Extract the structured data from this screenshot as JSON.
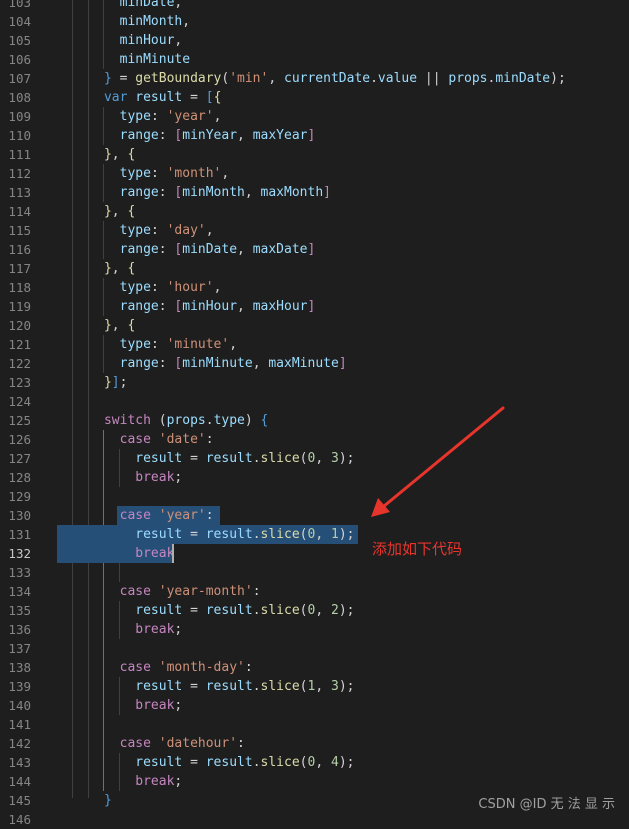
{
  "colors": {
    "background": "#1e1e1e",
    "line_number": "#858585",
    "variable": "#9cdcfe",
    "keyword_control": "#c586c0",
    "keyword": "#569cd6",
    "function": "#dcdcaa",
    "string": "#ce9178",
    "number": "#b5cea8",
    "selection": "#264f78",
    "annotation": "#e8352c"
  },
  "editor": {
    "active_line": 132,
    "lines": [
      {
        "num": "103",
        "tokens": [
          {
            "t": "        "
          },
          {
            "t": "minDate",
            "c": "variable"
          },
          {
            "t": ","
          }
        ]
      },
      {
        "num": "104",
        "tokens": [
          {
            "t": "        "
          },
          {
            "t": "minMonth",
            "c": "variable"
          },
          {
            "t": ","
          }
        ]
      },
      {
        "num": "105",
        "tokens": [
          {
            "t": "        "
          },
          {
            "t": "minHour",
            "c": "variable"
          },
          {
            "t": ","
          }
        ]
      },
      {
        "num": "106",
        "tokens": [
          {
            "t": "        "
          },
          {
            "t": "minMinute",
            "c": "variable"
          }
        ]
      },
      {
        "num": "107",
        "tokens": [
          {
            "t": "      "
          },
          {
            "t": "}",
            "c": "keyword"
          },
          {
            "t": " = "
          },
          {
            "t": "getBoundary",
            "c": "function"
          },
          {
            "t": "("
          },
          {
            "t": "'min'",
            "c": "string"
          },
          {
            "t": ", "
          },
          {
            "t": "currentDate",
            "c": "variable"
          },
          {
            "t": "."
          },
          {
            "t": "value",
            "c": "variable"
          },
          {
            "t": " || "
          },
          {
            "t": "props",
            "c": "variable"
          },
          {
            "t": "."
          },
          {
            "t": "minDate",
            "c": "variable"
          },
          {
            "t": ");"
          }
        ]
      },
      {
        "num": "108",
        "tokens": [
          {
            "t": "      "
          },
          {
            "t": "var",
            "c": "keyword"
          },
          {
            "t": " "
          },
          {
            "t": "result",
            "c": "variable"
          },
          {
            "t": " = "
          },
          {
            "t": "[",
            "c": "keyword"
          },
          {
            "t": "{",
            "c": "function"
          }
        ]
      },
      {
        "num": "109",
        "tokens": [
          {
            "t": "        "
          },
          {
            "t": "type",
            "c": "variable"
          },
          {
            "t": ": "
          },
          {
            "t": "'year'",
            "c": "string"
          },
          {
            "t": ","
          }
        ]
      },
      {
        "num": "110",
        "tokens": [
          {
            "t": "        "
          },
          {
            "t": "range",
            "c": "variable"
          },
          {
            "t": ": "
          },
          {
            "t": "[",
            "c": "keyword_control"
          },
          {
            "t": "minYear",
            "c": "variable"
          },
          {
            "t": ", "
          },
          {
            "t": "maxYear",
            "c": "variable"
          },
          {
            "t": "]",
            "c": "keyword_control"
          }
        ]
      },
      {
        "num": "111",
        "tokens": [
          {
            "t": "      "
          },
          {
            "t": "}",
            "c": "function"
          },
          {
            "t": ", "
          },
          {
            "t": "{",
            "c": "function"
          }
        ]
      },
      {
        "num": "112",
        "tokens": [
          {
            "t": "        "
          },
          {
            "t": "type",
            "c": "variable"
          },
          {
            "t": ": "
          },
          {
            "t": "'month'",
            "c": "string"
          },
          {
            "t": ","
          }
        ]
      },
      {
        "num": "113",
        "tokens": [
          {
            "t": "        "
          },
          {
            "t": "range",
            "c": "variable"
          },
          {
            "t": ": "
          },
          {
            "t": "[",
            "c": "keyword_control"
          },
          {
            "t": "minMonth",
            "c": "variable"
          },
          {
            "t": ", "
          },
          {
            "t": "maxMonth",
            "c": "variable"
          },
          {
            "t": "]",
            "c": "keyword_control"
          }
        ]
      },
      {
        "num": "114",
        "tokens": [
          {
            "t": "      "
          },
          {
            "t": "}",
            "c": "function"
          },
          {
            "t": ", "
          },
          {
            "t": "{",
            "c": "function"
          }
        ]
      },
      {
        "num": "115",
        "tokens": [
          {
            "t": "        "
          },
          {
            "t": "type",
            "c": "variable"
          },
          {
            "t": ": "
          },
          {
            "t": "'day'",
            "c": "string"
          },
          {
            "t": ","
          }
        ]
      },
      {
        "num": "116",
        "tokens": [
          {
            "t": "        "
          },
          {
            "t": "range",
            "c": "variable"
          },
          {
            "t": ": "
          },
          {
            "t": "[",
            "c": "keyword_control"
          },
          {
            "t": "minDate",
            "c": "variable"
          },
          {
            "t": ", "
          },
          {
            "t": "maxDate",
            "c": "variable"
          },
          {
            "t": "]",
            "c": "keyword_control"
          }
        ]
      },
      {
        "num": "117",
        "tokens": [
          {
            "t": "      "
          },
          {
            "t": "}",
            "c": "function"
          },
          {
            "t": ", "
          },
          {
            "t": "{",
            "c": "function"
          }
        ]
      },
      {
        "num": "118",
        "tokens": [
          {
            "t": "        "
          },
          {
            "t": "type",
            "c": "variable"
          },
          {
            "t": ": "
          },
          {
            "t": "'hour'",
            "c": "string"
          },
          {
            "t": ","
          }
        ]
      },
      {
        "num": "119",
        "tokens": [
          {
            "t": "        "
          },
          {
            "t": "range",
            "c": "variable"
          },
          {
            "t": ": "
          },
          {
            "t": "[",
            "c": "keyword_control"
          },
          {
            "t": "minHour",
            "c": "variable"
          },
          {
            "t": ", "
          },
          {
            "t": "maxHour",
            "c": "variable"
          },
          {
            "t": "]",
            "c": "keyword_control"
          }
        ]
      },
      {
        "num": "120",
        "tokens": [
          {
            "t": "      "
          },
          {
            "t": "}",
            "c": "function"
          },
          {
            "t": ", "
          },
          {
            "t": "{",
            "c": "function"
          }
        ]
      },
      {
        "num": "121",
        "tokens": [
          {
            "t": "        "
          },
          {
            "t": "type",
            "c": "variable"
          },
          {
            "t": ": "
          },
          {
            "t": "'minute'",
            "c": "string"
          },
          {
            "t": ","
          }
        ]
      },
      {
        "num": "122",
        "tokens": [
          {
            "t": "        "
          },
          {
            "t": "range",
            "c": "variable"
          },
          {
            "t": ": "
          },
          {
            "t": "[",
            "c": "keyword_control"
          },
          {
            "t": "minMinute",
            "c": "variable"
          },
          {
            "t": ", "
          },
          {
            "t": "maxMinute",
            "c": "variable"
          },
          {
            "t": "]",
            "c": "keyword_control"
          }
        ]
      },
      {
        "num": "123",
        "tokens": [
          {
            "t": "      "
          },
          {
            "t": "}",
            "c": "function"
          },
          {
            "t": "]",
            "c": "keyword"
          },
          {
            "t": ";"
          }
        ]
      },
      {
        "num": "124",
        "tokens": []
      },
      {
        "num": "125",
        "tokens": [
          {
            "t": "      "
          },
          {
            "t": "switch",
            "c": "keyword_control"
          },
          {
            "t": " ("
          },
          {
            "t": "props",
            "c": "variable"
          },
          {
            "t": "."
          },
          {
            "t": "type",
            "c": "variable"
          },
          {
            "t": ") "
          },
          {
            "t": "{",
            "c": "keyword"
          }
        ]
      },
      {
        "num": "126",
        "tokens": [
          {
            "t": "        "
          },
          {
            "t": "case",
            "c": "keyword_control"
          },
          {
            "t": " "
          },
          {
            "t": "'date'",
            "c": "string"
          },
          {
            "t": ":"
          }
        ]
      },
      {
        "num": "127",
        "tokens": [
          {
            "t": "          "
          },
          {
            "t": "result",
            "c": "variable"
          },
          {
            "t": " = "
          },
          {
            "t": "result",
            "c": "variable"
          },
          {
            "t": "."
          },
          {
            "t": "slice",
            "c": "function"
          },
          {
            "t": "("
          },
          {
            "t": "0",
            "c": "number"
          },
          {
            "t": ", "
          },
          {
            "t": "3",
            "c": "number"
          },
          {
            "t": ");"
          }
        ]
      },
      {
        "num": "128",
        "tokens": [
          {
            "t": "          "
          },
          {
            "t": "break",
            "c": "keyword_control"
          },
          {
            "t": ";"
          }
        ]
      },
      {
        "num": "129",
        "tokens": []
      },
      {
        "num": "130",
        "tokens": [
          {
            "t": "        "
          },
          {
            "t": "case",
            "c": "keyword_control"
          },
          {
            "t": " "
          },
          {
            "t": "'year'",
            "c": "string"
          },
          {
            "t": ":"
          }
        ]
      },
      {
        "num": "131",
        "tokens": [
          {
            "t": "          "
          },
          {
            "t": "result",
            "c": "variable"
          },
          {
            "t": " = "
          },
          {
            "t": "result",
            "c": "variable"
          },
          {
            "t": "."
          },
          {
            "t": "slice",
            "c": "function"
          },
          {
            "t": "("
          },
          {
            "t": "0",
            "c": "number"
          },
          {
            "t": ", "
          },
          {
            "t": "1",
            "c": "number"
          },
          {
            "t": ");"
          }
        ]
      },
      {
        "num": "132",
        "tokens": [
          {
            "t": "          "
          },
          {
            "t": "break",
            "c": "keyword_control"
          }
        ]
      },
      {
        "num": "133",
        "tokens": []
      },
      {
        "num": "134",
        "tokens": [
          {
            "t": "        "
          },
          {
            "t": "case",
            "c": "keyword_control"
          },
          {
            "t": " "
          },
          {
            "t": "'year-month'",
            "c": "string"
          },
          {
            "t": ":"
          }
        ]
      },
      {
        "num": "135",
        "tokens": [
          {
            "t": "          "
          },
          {
            "t": "result",
            "c": "variable"
          },
          {
            "t": " = "
          },
          {
            "t": "result",
            "c": "variable"
          },
          {
            "t": "."
          },
          {
            "t": "slice",
            "c": "function"
          },
          {
            "t": "("
          },
          {
            "t": "0",
            "c": "number"
          },
          {
            "t": ", "
          },
          {
            "t": "2",
            "c": "number"
          },
          {
            "t": ");"
          }
        ]
      },
      {
        "num": "136",
        "tokens": [
          {
            "t": "          "
          },
          {
            "t": "break",
            "c": "keyword_control"
          },
          {
            "t": ";"
          }
        ]
      },
      {
        "num": "137",
        "tokens": []
      },
      {
        "num": "138",
        "tokens": [
          {
            "t": "        "
          },
          {
            "t": "case",
            "c": "keyword_control"
          },
          {
            "t": " "
          },
          {
            "t": "'month-day'",
            "c": "string"
          },
          {
            "t": ":"
          }
        ]
      },
      {
        "num": "139",
        "tokens": [
          {
            "t": "          "
          },
          {
            "t": "result",
            "c": "variable"
          },
          {
            "t": " = "
          },
          {
            "t": "result",
            "c": "variable"
          },
          {
            "t": "."
          },
          {
            "t": "slice",
            "c": "function"
          },
          {
            "t": "("
          },
          {
            "t": "1",
            "c": "number"
          },
          {
            "t": ", "
          },
          {
            "t": "3",
            "c": "number"
          },
          {
            "t": ");"
          }
        ]
      },
      {
        "num": "140",
        "tokens": [
          {
            "t": "          "
          },
          {
            "t": "break",
            "c": "keyword_control"
          },
          {
            "t": ";"
          }
        ]
      },
      {
        "num": "141",
        "tokens": []
      },
      {
        "num": "142",
        "tokens": [
          {
            "t": "        "
          },
          {
            "t": "case",
            "c": "keyword_control"
          },
          {
            "t": " "
          },
          {
            "t": "'datehour'",
            "c": "string"
          },
          {
            "t": ":"
          }
        ]
      },
      {
        "num": "143",
        "tokens": [
          {
            "t": "          "
          },
          {
            "t": "result",
            "c": "variable"
          },
          {
            "t": " = "
          },
          {
            "t": "result",
            "c": "variable"
          },
          {
            "t": "."
          },
          {
            "t": "slice",
            "c": "function"
          },
          {
            "t": "("
          },
          {
            "t": "0",
            "c": "number"
          },
          {
            "t": ", "
          },
          {
            "t": "4",
            "c": "number"
          },
          {
            "t": ");"
          }
        ]
      },
      {
        "num": "144",
        "tokens": [
          {
            "t": "          "
          },
          {
            "t": "break",
            "c": "keyword_control"
          },
          {
            "t": ";"
          }
        ]
      },
      {
        "num": "145",
        "tokens": [
          {
            "t": "      "
          },
          {
            "t": "}",
            "c": "keyword"
          }
        ]
      },
      {
        "num": "146",
        "tokens": []
      }
    ]
  },
  "annotation": {
    "text": "添加如下代码"
  },
  "watermark": {
    "text": "CSDN @ID 无 法 显 示"
  }
}
